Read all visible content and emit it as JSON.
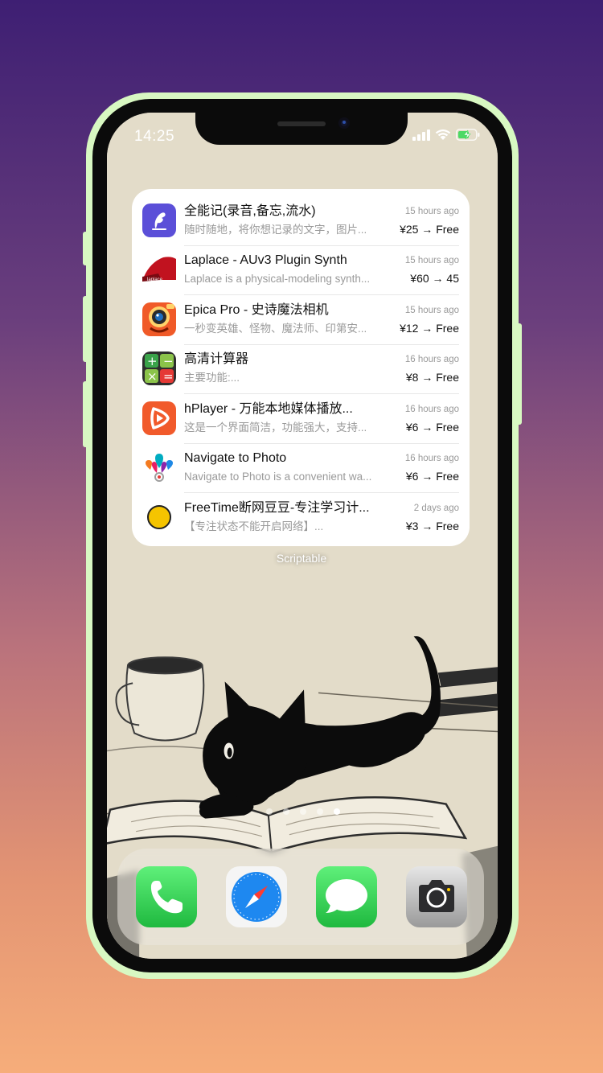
{
  "status_bar": {
    "time": "14:25"
  },
  "widget": {
    "apps": [
      {
        "name": "全能记(录音,备忘,流水)",
        "description": "随时随地，将你想记录的文字，图片...",
        "ago": "15 hours ago",
        "price": "¥25 → Free",
        "icon": "quill-icon",
        "color": "#5b4fd8"
      },
      {
        "name": "Laplace - AUv3 Plugin Synth",
        "description": "Laplace is a physical-modeling synth...",
        "ago": "15 hours ago",
        "price": "¥60 → 45",
        "icon": "laplace-logo-icon",
        "color": "#c1121f"
      },
      {
        "name": "Epica Pro - 史诗魔法相机",
        "description": "一秒变英雄、怪物、魔法师、印第安...",
        "ago": "15 hours ago",
        "price": "¥12 → Free",
        "icon": "camera-lens-icon",
        "color": "#f05a28"
      },
      {
        "name": "高清计算器",
        "description": "主要功能:...",
        "ago": "16 hours ago",
        "price": "¥8 → Free",
        "icon": "calculator-icon",
        "color": "#3aa34a"
      },
      {
        "name": "hPlayer - 万能本地媒体播放...",
        "description": "这是一个界面简洁，功能强大，支持...",
        "ago": "16 hours ago",
        "price": "¥6 → Free",
        "icon": "play-icon",
        "color": "#f15a2b"
      },
      {
        "name": "Navigate to Photo",
        "description": "Navigate to Photo is a convenient wa...",
        "ago": "16 hours ago",
        "price": "¥6 → Free",
        "icon": "map-pins-icon",
        "color": "#ffffff"
      },
      {
        "name": "FreeTime断网豆豆-专注学习计...",
        "description": "【专注状态不能开启网络】...",
        "ago": "2 days ago",
        "price": "¥3 → Free",
        "icon": "yellow-dot-icon",
        "color": "#f5c400"
      }
    ],
    "label": "Scriptable"
  },
  "dock": {
    "apps": [
      {
        "icon": "phone-icon",
        "color": "#34c759"
      },
      {
        "icon": "safari-icon",
        "color": "#1e88f0"
      },
      {
        "icon": "messages-icon",
        "color": "#34c759"
      },
      {
        "icon": "camera-icon",
        "color": "#8e8e93"
      }
    ]
  },
  "page_dots": {
    "count": 5,
    "active": 5
  }
}
